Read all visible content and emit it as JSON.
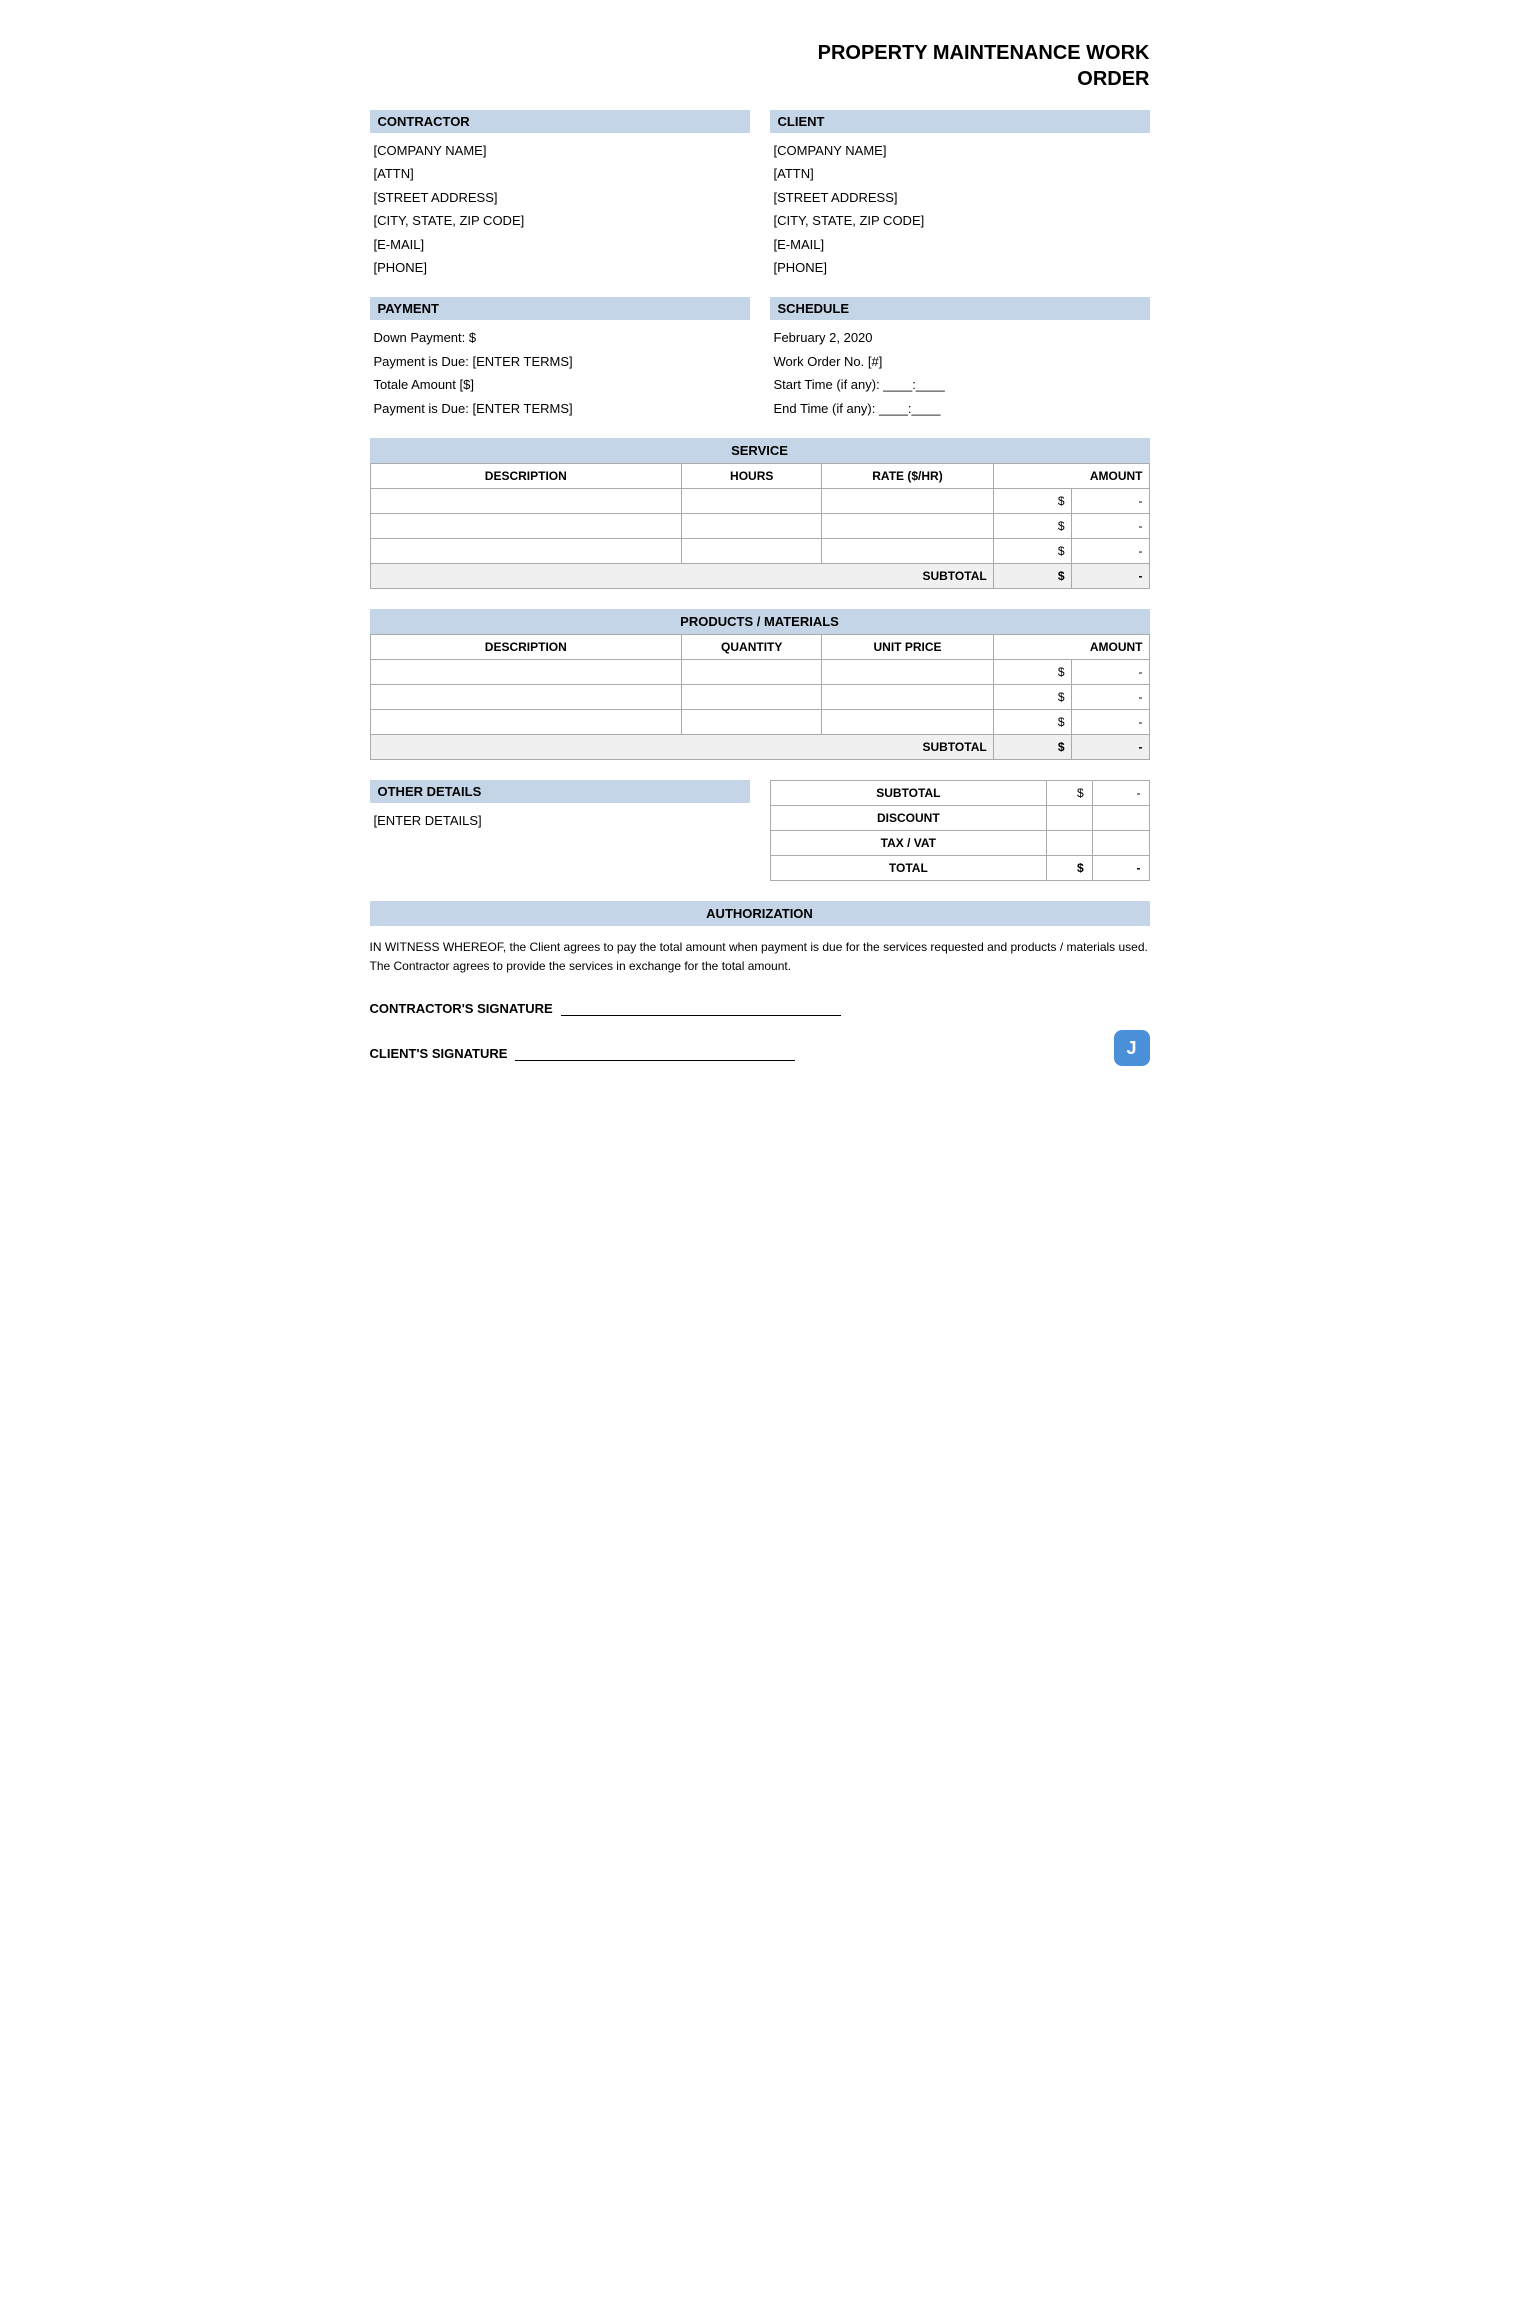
{
  "title": {
    "line1": "PROPERTY MAINTENANCE WORK",
    "line2": "ORDER"
  },
  "contractor": {
    "label": "CONTRACTOR",
    "company": "[COMPANY NAME]",
    "attn": "[ATTN]",
    "address": "[STREET ADDRESS]",
    "city": "[CITY, STATE, ZIP CODE]",
    "email": "[E-MAIL]",
    "phone": "[PHONE]"
  },
  "client": {
    "label": "CLIENT",
    "company": "[COMPANY NAME]",
    "attn": "[ATTN]",
    "address": "[STREET ADDRESS]",
    "city": "[CITY, STATE, ZIP CODE]",
    "email": "[E-MAIL]",
    "phone": "[PHONE]"
  },
  "payment": {
    "label": "PAYMENT",
    "down": "Down Payment: $",
    "due1": "Payment is Due: [ENTER TERMS]",
    "total": "Totale Amount [$]",
    "due2": "Payment is Due: [ENTER TERMS]"
  },
  "schedule": {
    "label": "SCHEDULE",
    "date": "February 2, 2020",
    "work_order": "Work Order No. [#]",
    "start_time": "Start Time (if any): ____:____",
    "end_time": "End Time (if any):  ____:____"
  },
  "service": {
    "section_title": "SERVICE",
    "col_description": "DESCRIPTION",
    "col_hours": "HOURS",
    "col_rate": "RATE ($/HR)",
    "col_amount": "AMOUNT",
    "rows": [
      {
        "description": "",
        "hours": "",
        "rate": "",
        "dollar": "$",
        "amount": "-"
      },
      {
        "description": "",
        "hours": "",
        "rate": "",
        "dollar": "$",
        "amount": "-"
      },
      {
        "description": "",
        "hours": "",
        "rate": "",
        "dollar": "$",
        "amount": "-"
      }
    ],
    "subtotal_label": "SUBTOTAL",
    "subtotal_dollar": "$",
    "subtotal_value": "-"
  },
  "materials": {
    "section_title": "PRODUCTS / MATERIALS",
    "col_description": "DESCRIPTION",
    "col_quantity": "QUANTITY",
    "col_unit_price": "UNIT PRICE",
    "col_amount": "AMOUNT",
    "rows": [
      {
        "description": "",
        "quantity": "",
        "unit_price": "",
        "dollar": "$",
        "amount": "-"
      },
      {
        "description": "",
        "quantity": "",
        "unit_price": "",
        "dollar": "$",
        "amount": "-"
      },
      {
        "description": "",
        "quantity": "",
        "unit_price": "",
        "dollar": "$",
        "amount": "-"
      }
    ],
    "subtotal_label": "SUBTOTAL",
    "subtotal_dollar": "$",
    "subtotal_value": "-"
  },
  "other_details": {
    "label": "OTHER DETAILS",
    "value": "[ENTER DETAILS]"
  },
  "summary": {
    "subtotal_label": "SUBTOTAL",
    "subtotal_dollar": "$",
    "subtotal_value": "-",
    "discount_label": "DISCOUNT",
    "tax_label": "TAX / VAT",
    "total_label": "TOTAL",
    "total_dollar": "$",
    "total_value": "-"
  },
  "authorization": {
    "label": "AUTHORIZATION",
    "text": "IN WITNESS WHEREOF, the Client agrees to pay the total amount when payment is due for the services requested and products / materials used. The Contractor agrees to provide the services in exchange for the total amount.",
    "contractor_sig_label": "CONTRACTOR'S SIGNATURE",
    "client_sig_label": "CLIENT'S SIGNATURE"
  }
}
